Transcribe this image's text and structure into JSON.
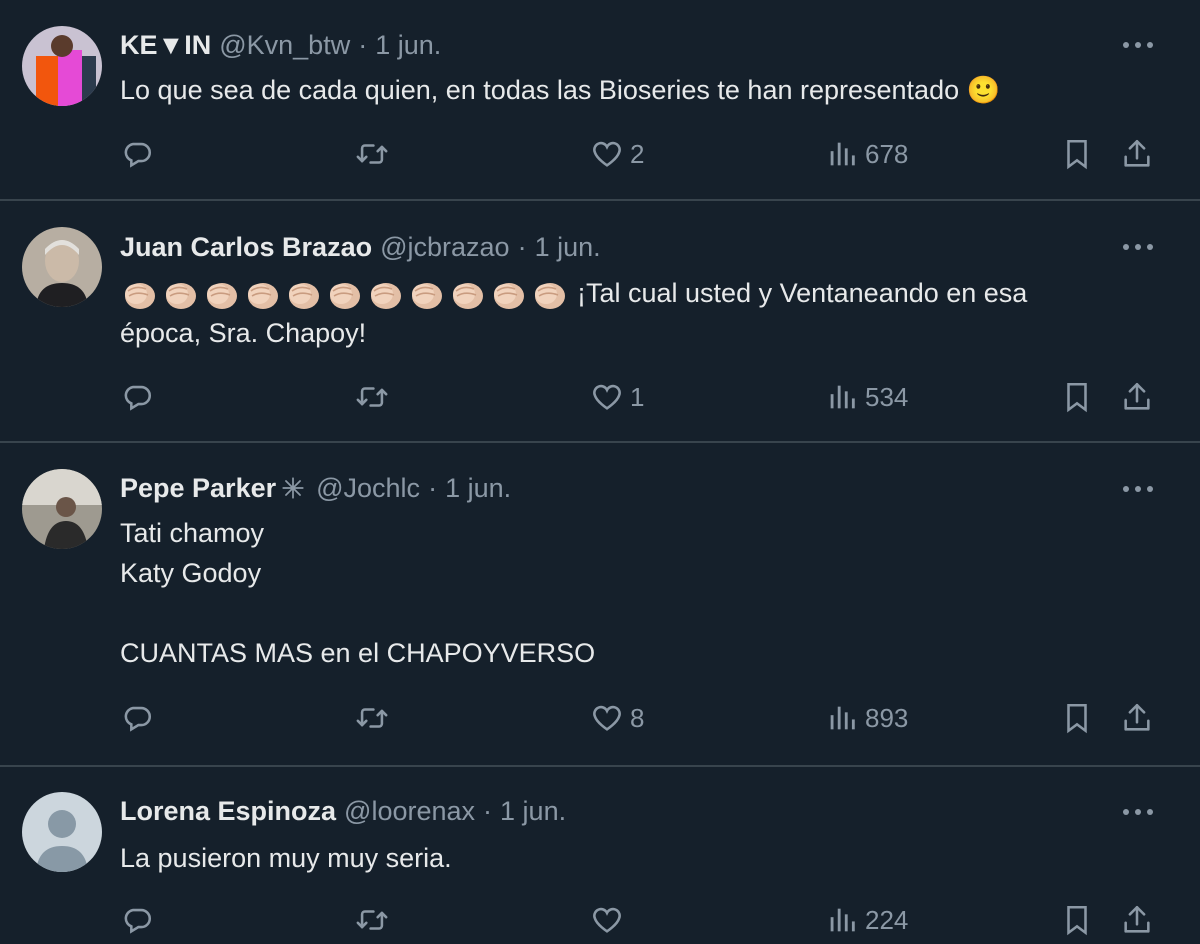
{
  "tweets": [
    {
      "name": "KE▼IN",
      "handle": "@Kvn_btw",
      "sep": "·",
      "time": "1 jun.",
      "lines": [
        "Lo que sea de cada quien, en todas las Bioseries te han representado 🙂"
      ],
      "likes": "2",
      "views": "678",
      "avatar_colors": [
        "#c8c0cf",
        "#f0520c",
        "#e44ad8",
        "#2b3a4c"
      ]
    },
    {
      "name": "Juan Carlos Brazao",
      "handle": "@jcbrazao",
      "sep": "·",
      "time": "1 jun.",
      "line1_text": "¡Tal cual usted y Ventaneando en esa",
      "line2_text": "época, Sra. Chapoy!",
      "clap_emoji": "👏",
      "clap_count": 11,
      "likes": "1",
      "views": "534"
    },
    {
      "name": "Pepe Parker",
      "handle": "@Jochlc",
      "sep": "·",
      "time": "1 jun.",
      "lines": [
        "Tati chamoy",
        "Katy Godoy",
        "",
        "CUANTAS MAS en el CHAPOYVERSO"
      ],
      "likes": "8",
      "views": "893"
    },
    {
      "name": "Lorena Espinoza",
      "handle": "@loorenax",
      "sep": "·",
      "time": "1 jun.",
      "lines": [
        "La pusieron muy muy seria."
      ],
      "likes": "",
      "views": "224"
    }
  ],
  "icons": {
    "reply": "reply-icon",
    "retweet": "retweet-icon",
    "like": "heart-icon",
    "views": "views-icon",
    "bookmark": "bookmark-icon",
    "share": "share-icon",
    "more": "more-icon"
  },
  "colors": {
    "background": "#15202b",
    "divider": "#38444d",
    "text": "#e7e9ea",
    "muted": "#8b98a5"
  }
}
